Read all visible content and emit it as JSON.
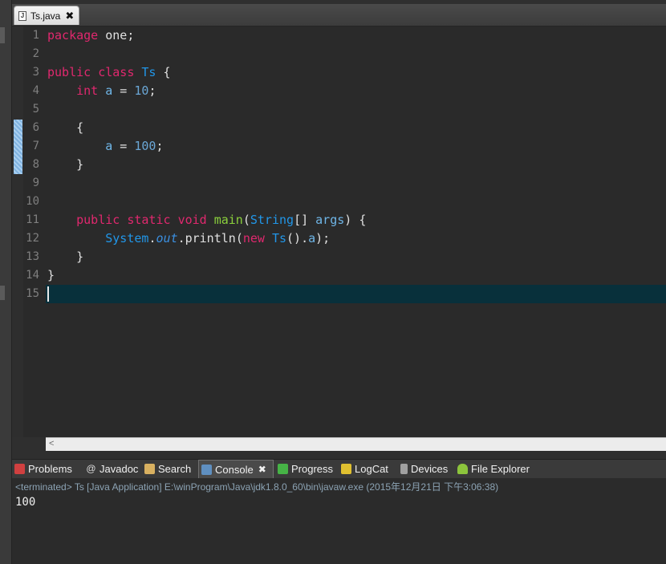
{
  "editor": {
    "tab_title": "Ts.java",
    "line_numbers": [
      "1",
      "2",
      "3",
      "4",
      "5",
      "6",
      "7",
      "8",
      "9",
      "10",
      "11",
      "12",
      "13",
      "14",
      "15"
    ]
  },
  "code": {
    "l1": {
      "kw": "package",
      "rest": " one;"
    },
    "l3": {
      "kw1": "public",
      "kw2": "class",
      "cls": "Ts",
      "rest": " {"
    },
    "l4": {
      "kw": "int",
      "var": "a",
      "op": " = ",
      "num": "10",
      "rest": ";"
    },
    "l6": "{",
    "l7": {
      "var": "a",
      "op": " = ",
      "num": "100",
      "rest": ";"
    },
    "l8": "}",
    "l11": {
      "kw1": "public",
      "kw2": "static",
      "kw3": "void",
      "fn": "main",
      "paren": "(",
      "cls": "String",
      "arr": "[] ",
      "param": "args",
      "rest": ") {"
    },
    "l12": {
      "cls": "System",
      "dot1": ".",
      "fld": "out",
      "dot2": ".",
      "method": "println",
      "paren": "(",
      "kw": "new",
      "cls2": "Ts",
      "rest1": "().",
      "var": "a",
      "rest2": ");"
    },
    "l13": "}",
    "l14": "}"
  },
  "views": {
    "tabs": [
      "Problems",
      "Javadoc",
      "Search",
      "Console",
      "Progress",
      "LogCat",
      "Devices",
      "File Explorer"
    ]
  },
  "console": {
    "status": "<terminated> Ts [Java Application] E:\\winProgram\\Java\\jdk1.8.0_60\\bin\\javaw.exe (2015年12月21日 下午3:06:38)",
    "output": "100"
  }
}
